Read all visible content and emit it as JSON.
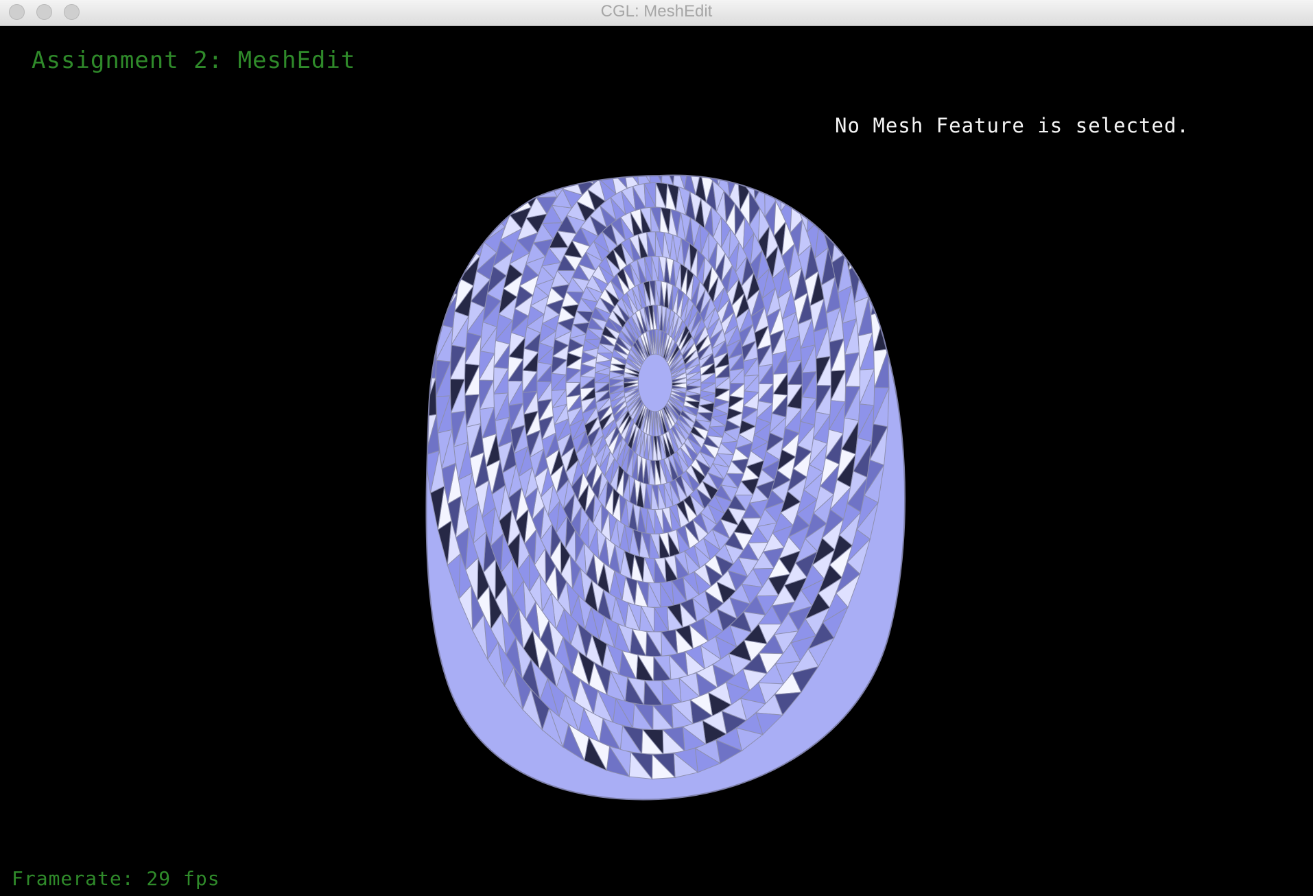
{
  "window": {
    "title": "CGL: MeshEdit"
  },
  "hud": {
    "assignment_title": "Assignment 2: MeshEdit",
    "selection_status": "No Mesh Feature is selected.",
    "framerate": "Framerate: 29 fps"
  },
  "colors": {
    "hud_green": "#2f8a2a",
    "hud_white": "#f4f4f4",
    "background": "#000000",
    "mesh_light": "#eef0ff",
    "mesh_mid": "#9aa0f0",
    "mesh_dark": "#262846"
  },
  "icons": {
    "close": "close-window-circle",
    "minimize": "minimize-window-circle",
    "zoom": "zoom-window-circle"
  }
}
